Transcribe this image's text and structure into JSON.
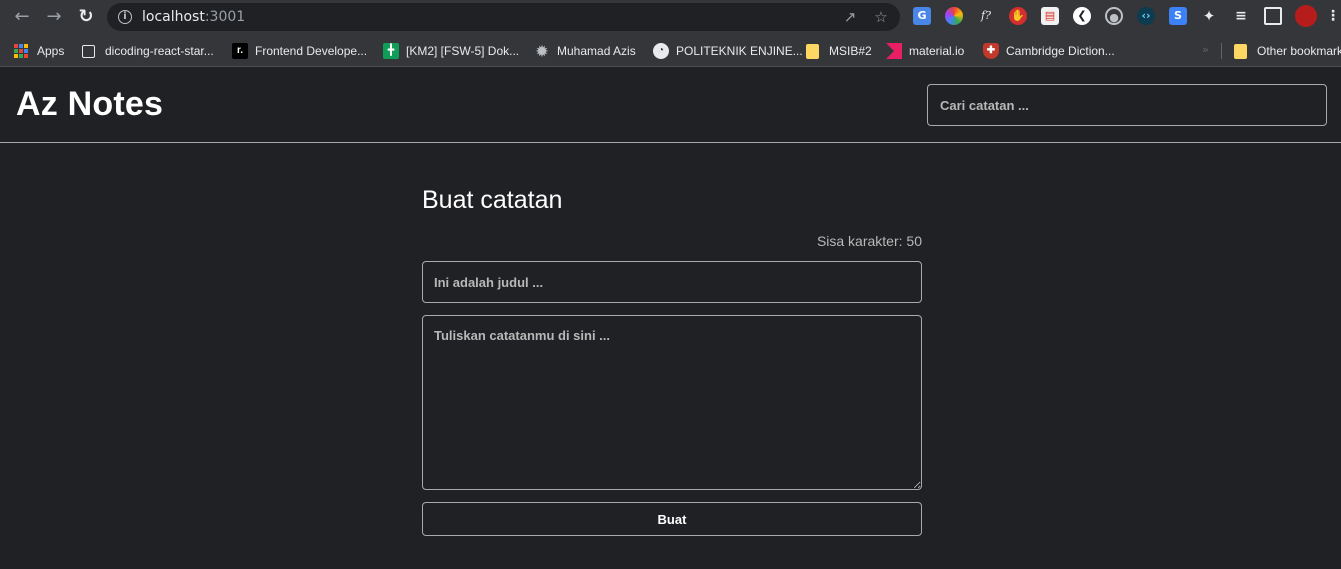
{
  "browser": {
    "url_host": "localhost",
    "url_port": ":3001",
    "icons": {
      "back": "arrow-left-icon",
      "forward": "arrow-right-icon",
      "reload": "reload-icon",
      "info": "info-icon",
      "share": "share-icon",
      "bookmark": "star-icon"
    },
    "extension_labels": {
      "formula": "f?"
    },
    "bookmarks": [
      {
        "label": "Apps",
        "icon": "apps-grid-icon"
      },
      {
        "label": "dicoding-react-star...",
        "icon": "page-icon"
      },
      {
        "label": "Frontend Develope...",
        "icon": "r-logo-icon"
      },
      {
        "label": "[KM2] [FSW-5] Dok...",
        "icon": "sheets-icon"
      },
      {
        "label": "Muhamad Azis",
        "icon": "seal-icon"
      },
      {
        "label": "POLITEKNIK ENJINE...",
        "icon": "globe-icon"
      },
      {
        "label": "MSIB#2",
        "icon": "folder-icon"
      },
      {
        "label": "material.io",
        "icon": "material-icon"
      },
      {
        "label": "Cambridge Diction...",
        "icon": "cambridge-icon"
      }
    ],
    "overflow_label": "»",
    "other_bookmarks": "Other bookmarks"
  },
  "app": {
    "title": "Az Notes",
    "search": {
      "placeholder": "Cari catatan ..."
    }
  },
  "note_form": {
    "heading": "Buat catatan",
    "char_limit": "Sisa karakter: 50",
    "title_placeholder": "Ini adalah judul ...",
    "body_placeholder": "Tuliskan catatanmu di sini ...",
    "submit_label": "Buat"
  }
}
